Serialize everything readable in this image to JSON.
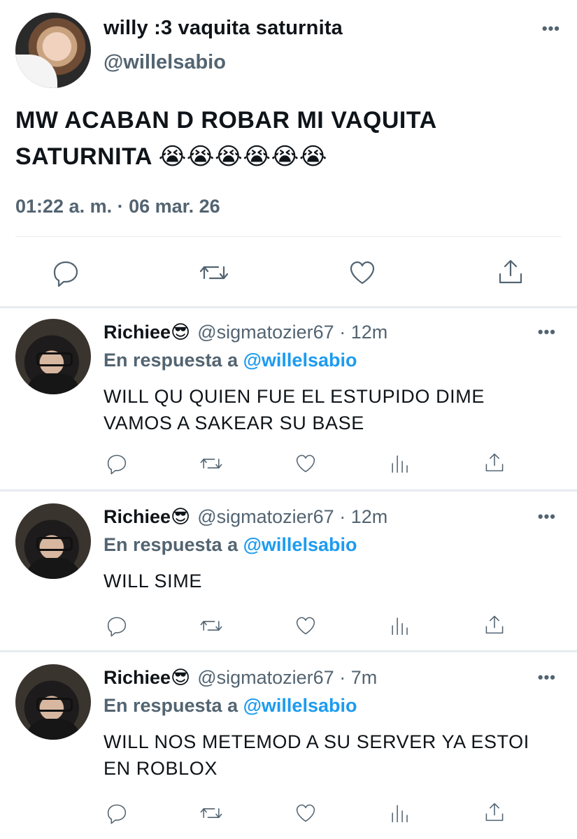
{
  "main_tweet": {
    "display_name": "willy :3 vaquita saturnita",
    "handle": "@willelsabio",
    "more_icon": "ellipsis-icon",
    "text": "MW ACABAN D ROBAR MI VAQUITA SATURNITA 😭😭😭😭😭😭",
    "timestamp": "01:22 a. m. · 06 mar. 26",
    "actions": [
      "reply-icon",
      "retweet-icon",
      "like-icon",
      "share-icon"
    ]
  },
  "replies": [
    {
      "display_name": "Richiee😎",
      "handle": "@sigmatozier67",
      "dot": " · ",
      "time": "12m",
      "reply_prefix": "En respuesta a ",
      "reply_to": "@willelsabio",
      "text": "WILL QU QUIEN FUE EL ESTUPIDO DIME VAMOS A SAKEAR SU BASE"
    },
    {
      "display_name": "Richiee😎",
      "handle": "@sigmatozier67",
      "dot": " · ",
      "time": "12m",
      "reply_prefix": "En respuesta a ",
      "reply_to": "@willelsabio",
      "text": "WILL SIME"
    },
    {
      "display_name": "Richiee😎",
      "handle": "@sigmatozier67",
      "dot": " · ",
      "time": "7m",
      "reply_prefix": "En respuesta a ",
      "reply_to": "@willelsabio",
      "text": "WILL NOS METEMOD A SU SERVER YA ESTOI EN ROBLOX"
    }
  ],
  "reply_actions": [
    "reply-icon",
    "retweet-icon",
    "like-icon",
    "analytics-icon",
    "share-icon"
  ],
  "colors": {
    "text": "#0f1419",
    "secondary": "#536471",
    "link": "#1d9bf0",
    "divider": "#e6ecf0"
  }
}
